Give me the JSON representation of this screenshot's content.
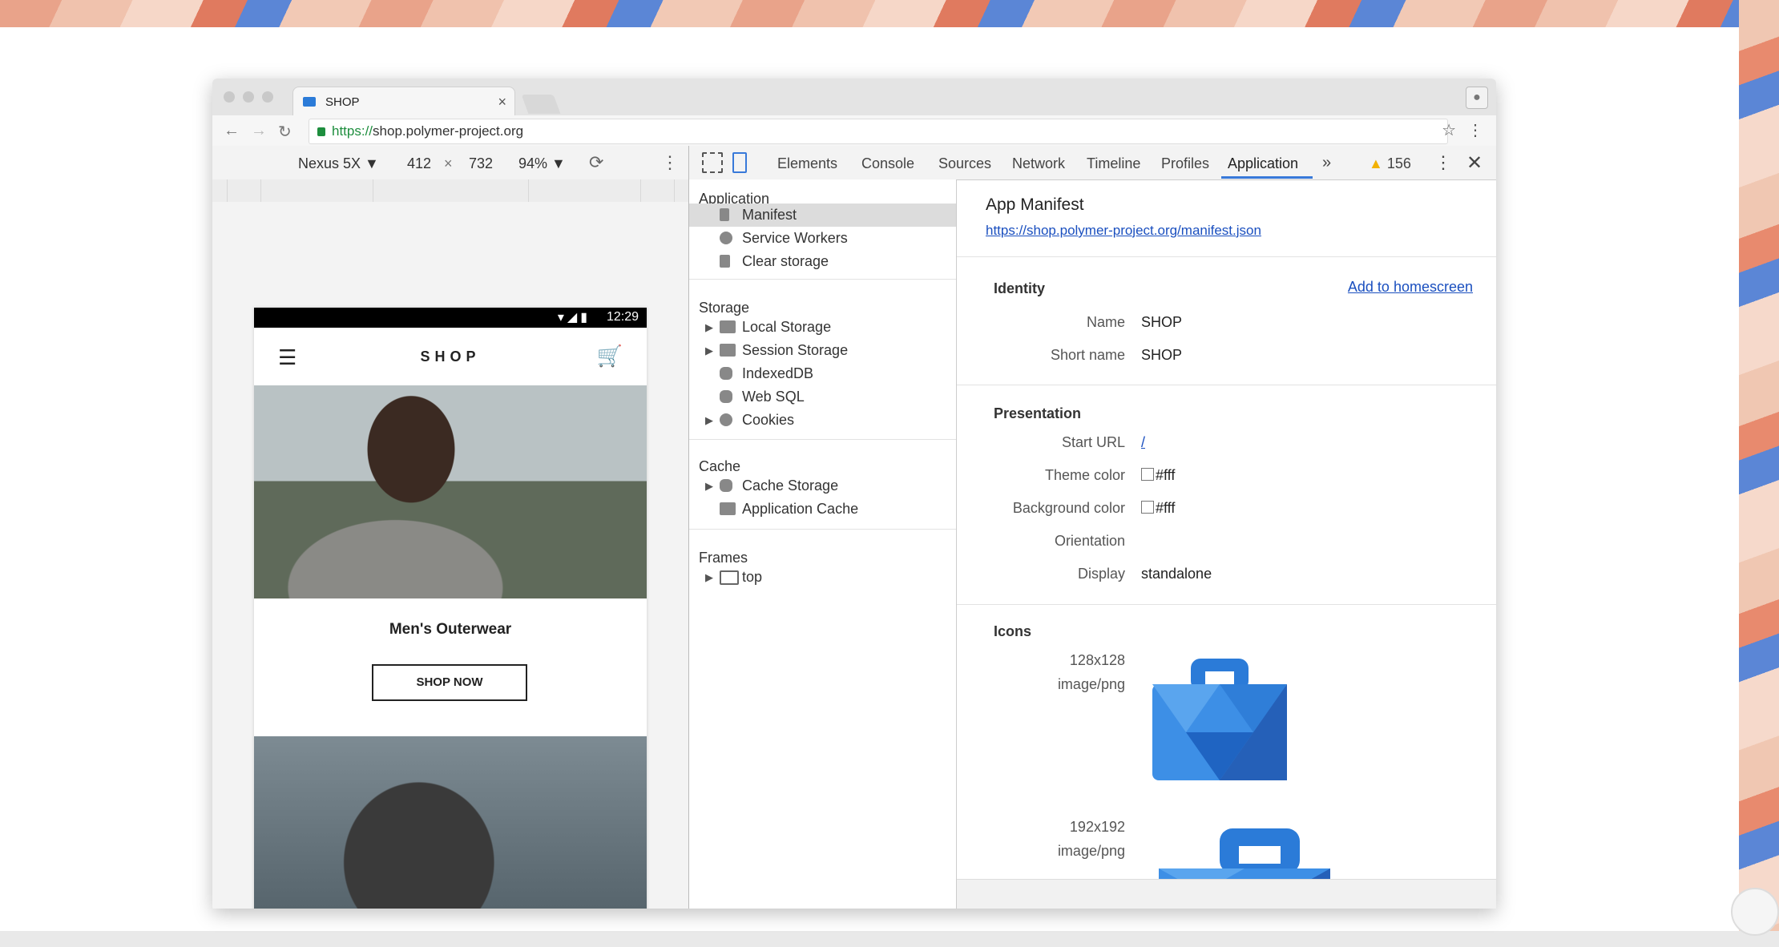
{
  "browser": {
    "tab_title": "SHOP",
    "url_scheme": "https://",
    "url_host": "shop.polymer-project.org"
  },
  "device_toolbar": {
    "device": "Nexus 5X",
    "width": "412",
    "times": "×",
    "height": "732",
    "zoom": "94%"
  },
  "phone": {
    "time": "12:29",
    "brand": "SHOP",
    "promo_title": "Men's Outerwear",
    "promo_button": "SHOP NOW"
  },
  "devtools": {
    "tabs": [
      "Elements",
      "Console",
      "Sources",
      "Network",
      "Timeline",
      "Profiles",
      "Application"
    ],
    "active_tab": "Application",
    "more": "»",
    "warning_count": "156"
  },
  "sidebar": {
    "sections": [
      {
        "title": "Application",
        "items": [
          {
            "label": "Manifest"
          },
          {
            "label": "Service Workers"
          },
          {
            "label": "Clear storage"
          }
        ]
      },
      {
        "title": "Storage",
        "items": [
          {
            "label": "Local Storage"
          },
          {
            "label": "Session Storage"
          },
          {
            "label": "IndexedDB"
          },
          {
            "label": "Web SQL"
          },
          {
            "label": "Cookies"
          }
        ]
      },
      {
        "title": "Cache",
        "items": [
          {
            "label": "Cache Storage"
          },
          {
            "label": "Application Cache"
          }
        ]
      },
      {
        "title": "Frames",
        "items": [
          {
            "label": "top"
          }
        ]
      }
    ]
  },
  "manifest": {
    "title": "App Manifest",
    "url": "https://shop.polymer-project.org/manifest.json",
    "identity": {
      "heading": "Identity",
      "add_to_homescreen": "Add to homescreen",
      "name_label": "Name",
      "name_value": "SHOP",
      "short_name_label": "Short name",
      "short_name_value": "SHOP"
    },
    "presentation": {
      "heading": "Presentation",
      "start_url_label": "Start URL",
      "start_url_value": "/",
      "theme_color_label": "Theme color",
      "theme_color_value": "#fff",
      "background_color_label": "Background color",
      "background_color_value": "#fff",
      "orientation_label": "Orientation",
      "display_label": "Display",
      "display_value": "standalone"
    },
    "icons": {
      "heading": "Icons",
      "items": [
        {
          "size": "128x128",
          "type": "image/png"
        },
        {
          "size": "192x192",
          "type": "image/png"
        }
      ]
    }
  },
  "colors": {
    "accent": "#3879d9",
    "link": "#1a4fbf",
    "secure": "#1e8e3e",
    "icon_blue": "#2b7bd8"
  }
}
